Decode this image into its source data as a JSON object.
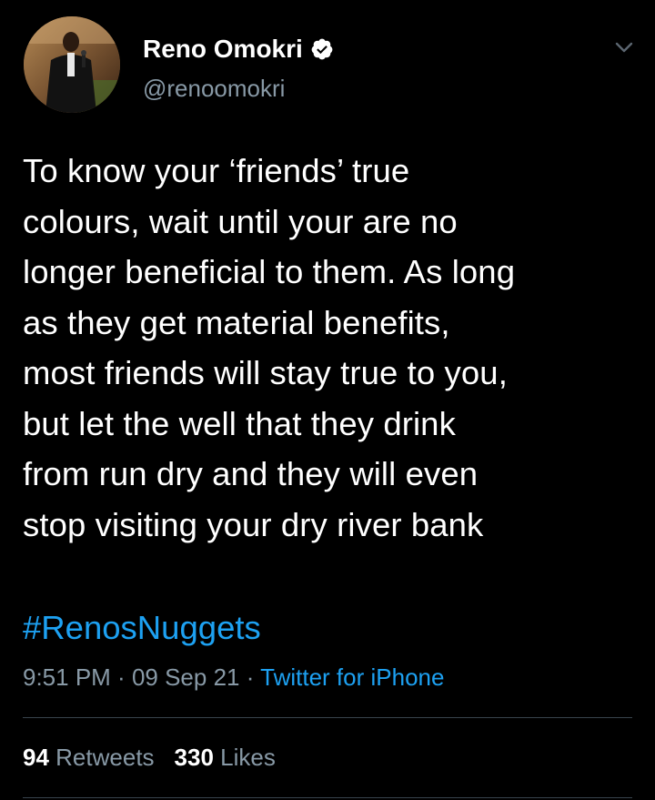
{
  "user": {
    "display_name": "Reno Omokri",
    "handle": "@renoomokri",
    "verified": true,
    "avatar_icon": "profile-photo"
  },
  "tweet": {
    "lines": [
      "To know your ‘friends’ true",
      "colours, wait until your are no",
      "longer beneficial to them. As long",
      "as they get material benefits,",
      "most friends will stay true to you,",
      "but let the well that they drink",
      "from run dry and they will even",
      "stop visiting your dry river bank"
    ],
    "hashtag": "#RenosNuggets"
  },
  "meta": {
    "time": "9:51 PM",
    "sep1": " · ",
    "date": "09 Sep 21",
    "sep2": " · ",
    "source": "Twitter for iPhone"
  },
  "stats": {
    "retweets_count": "94",
    "retweets_label": "Retweets",
    "likes_count": "330",
    "likes_label": "Likes"
  },
  "colors": {
    "background": "#000000",
    "text": "#ffffff",
    "secondary": "#8899a6",
    "accent": "#1da1f2",
    "divider": "#38444d"
  },
  "icons": {
    "verified": "verified-badge-icon",
    "menu": "chevron-down-icon"
  }
}
